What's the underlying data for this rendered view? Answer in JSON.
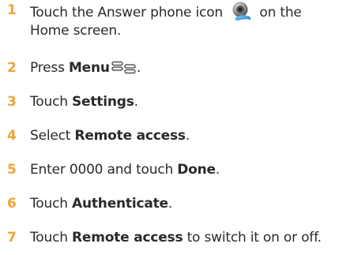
{
  "steps": [
    {
      "number": "1",
      "text_before": "Touch the Answer phone icon ",
      "icon": "answer-phone-icon",
      "text_after": " on the",
      "text_line2": "Home screen."
    },
    {
      "number": "2",
      "text_before": "Press ",
      "bold": "Menu",
      "icon": "menu-icon",
      "text_after": "."
    },
    {
      "number": "3",
      "text_before": "Touch ",
      "bold": "Settings",
      "text_after": "."
    },
    {
      "number": "4",
      "text_before": "Select ",
      "bold": "Remote access",
      "text_after": "."
    },
    {
      "number": "5",
      "text_before": "Enter 0000 and touch ",
      "bold": "Done",
      "text_after": "."
    },
    {
      "number": "6",
      "text_before": "Touch ",
      "bold": "Authenticate",
      "text_after": "."
    },
    {
      "number": "7",
      "text_before": "Touch ",
      "bold": "Remote access",
      "text_after": " to switch it on or off."
    }
  ],
  "colors": {
    "step_number": "#f0a33a",
    "text": "#2a2a2a",
    "icon_blue": "#1f7fc6"
  }
}
